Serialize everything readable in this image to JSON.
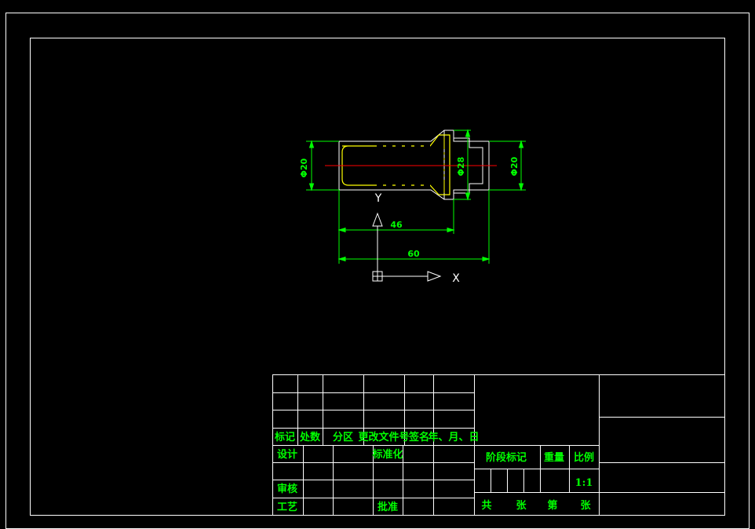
{
  "drawing": {
    "dimensions": {
      "dia_left": "Φ20",
      "dia_mid": "Φ28",
      "dia_right": "Φ20",
      "len_46": "46",
      "len_60": "60"
    },
    "ucs": {
      "x_label": "X",
      "y_label": "Y"
    }
  },
  "title_block": {
    "rev_headers": [
      "标记",
      "处数",
      "分区",
      "更改文件号",
      "签名",
      "年、月、日"
    ],
    "design": "设计",
    "standardize": "标准化",
    "review": "审核",
    "process": "工艺",
    "approve": "批准",
    "stage_mark": "阶段标记",
    "weight": "重量",
    "scale_label": "比例",
    "scale_value": "1:1",
    "total": "共",
    "sheets1": "张",
    "sheet_no": "第",
    "sheets2": "张"
  },
  "colors": {
    "outline": "#ffffff",
    "part": "#ffff00",
    "dimension": "#00ff00",
    "centerline": "#ff0000",
    "background": "#000000"
  }
}
